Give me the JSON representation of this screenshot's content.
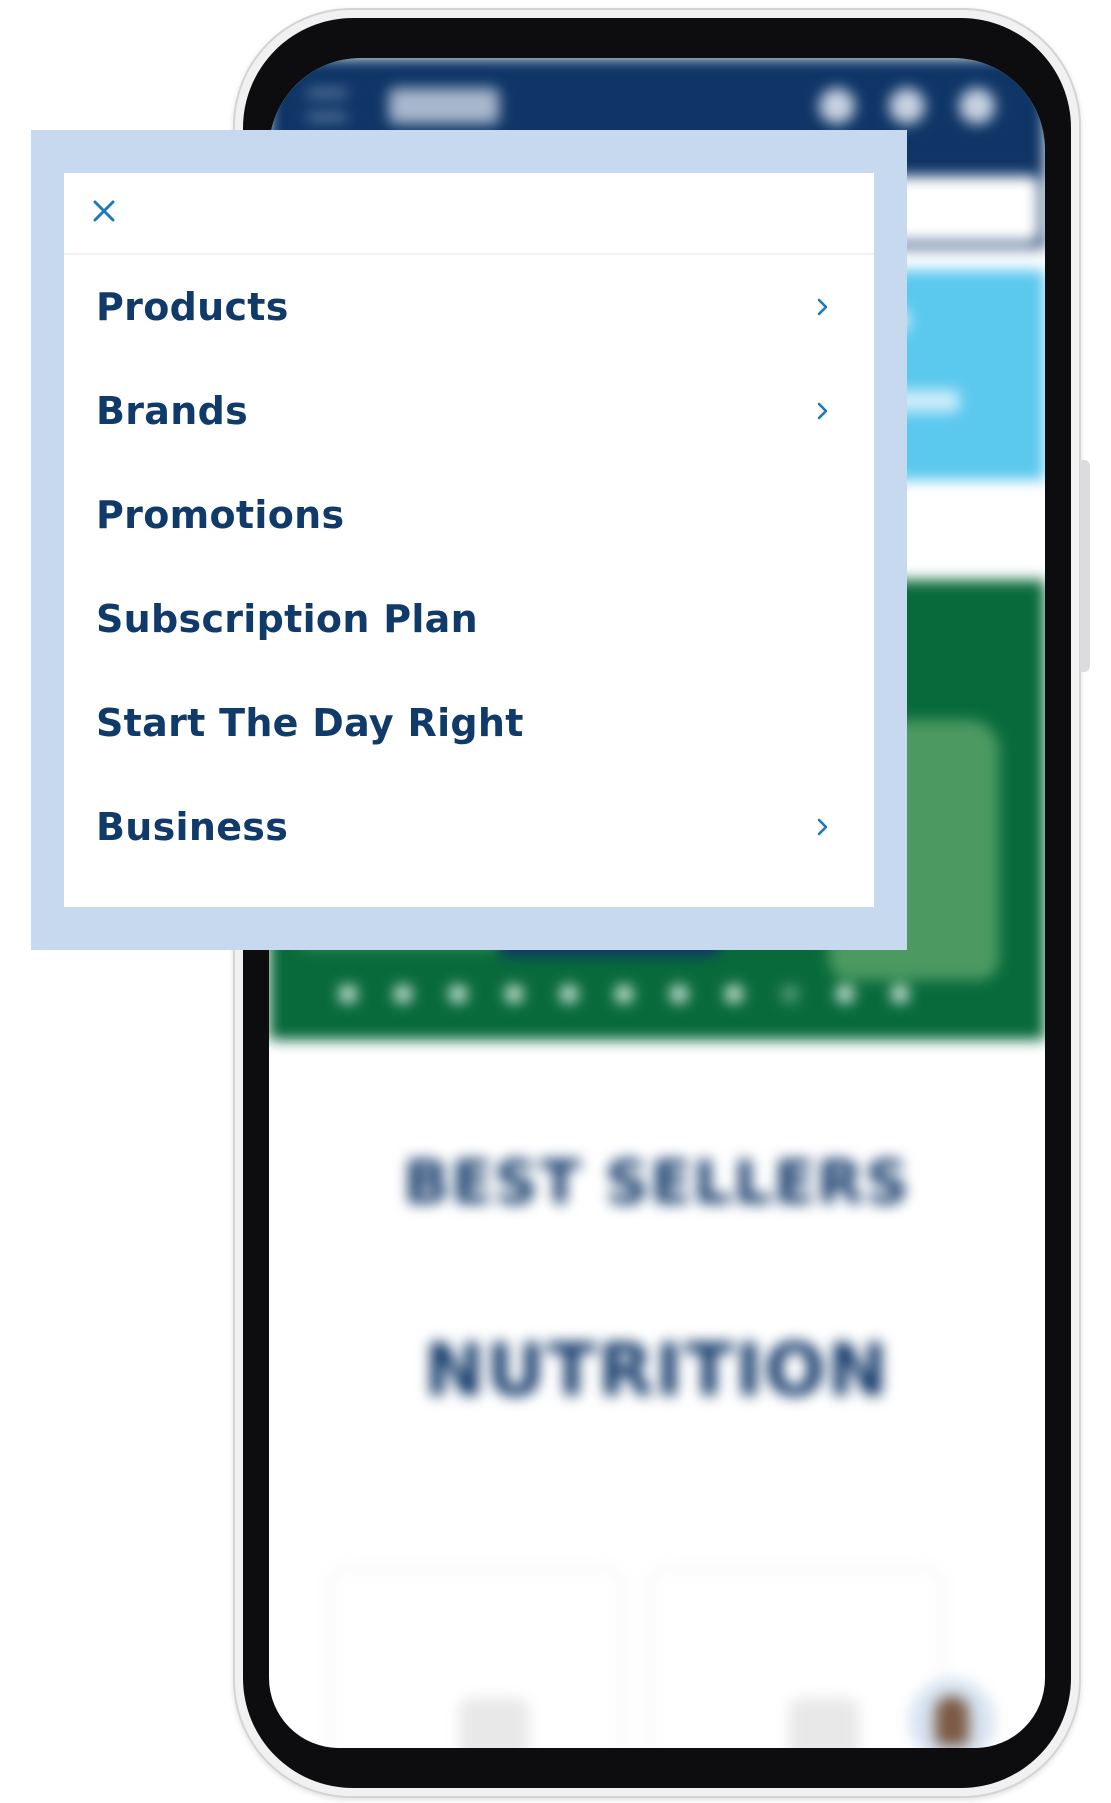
{
  "background_site": {
    "section_heading": "BEST SELLERS",
    "category_heading": "NUTRITION"
  },
  "menu": {
    "close_icon": "close-icon",
    "chevron_icon": "chevron-right-icon",
    "items": [
      {
        "label": "Products",
        "has_submenu": true
      },
      {
        "label": "Brands",
        "has_submenu": true
      },
      {
        "label": "Promotions",
        "has_submenu": false
      },
      {
        "label": "Subscription Plan",
        "has_submenu": false
      },
      {
        "label": "Start The Day Right",
        "has_submenu": false
      },
      {
        "label": "Business",
        "has_submenu": true
      }
    ]
  },
  "colors": {
    "menu_text": "#103a6a",
    "accent_icon": "#1b7bb8",
    "frame_bg": "#c6d9ef",
    "header_navy": "#0e3566",
    "hero_green": "#086a3b",
    "promo_blue": "#5bc8ee"
  }
}
